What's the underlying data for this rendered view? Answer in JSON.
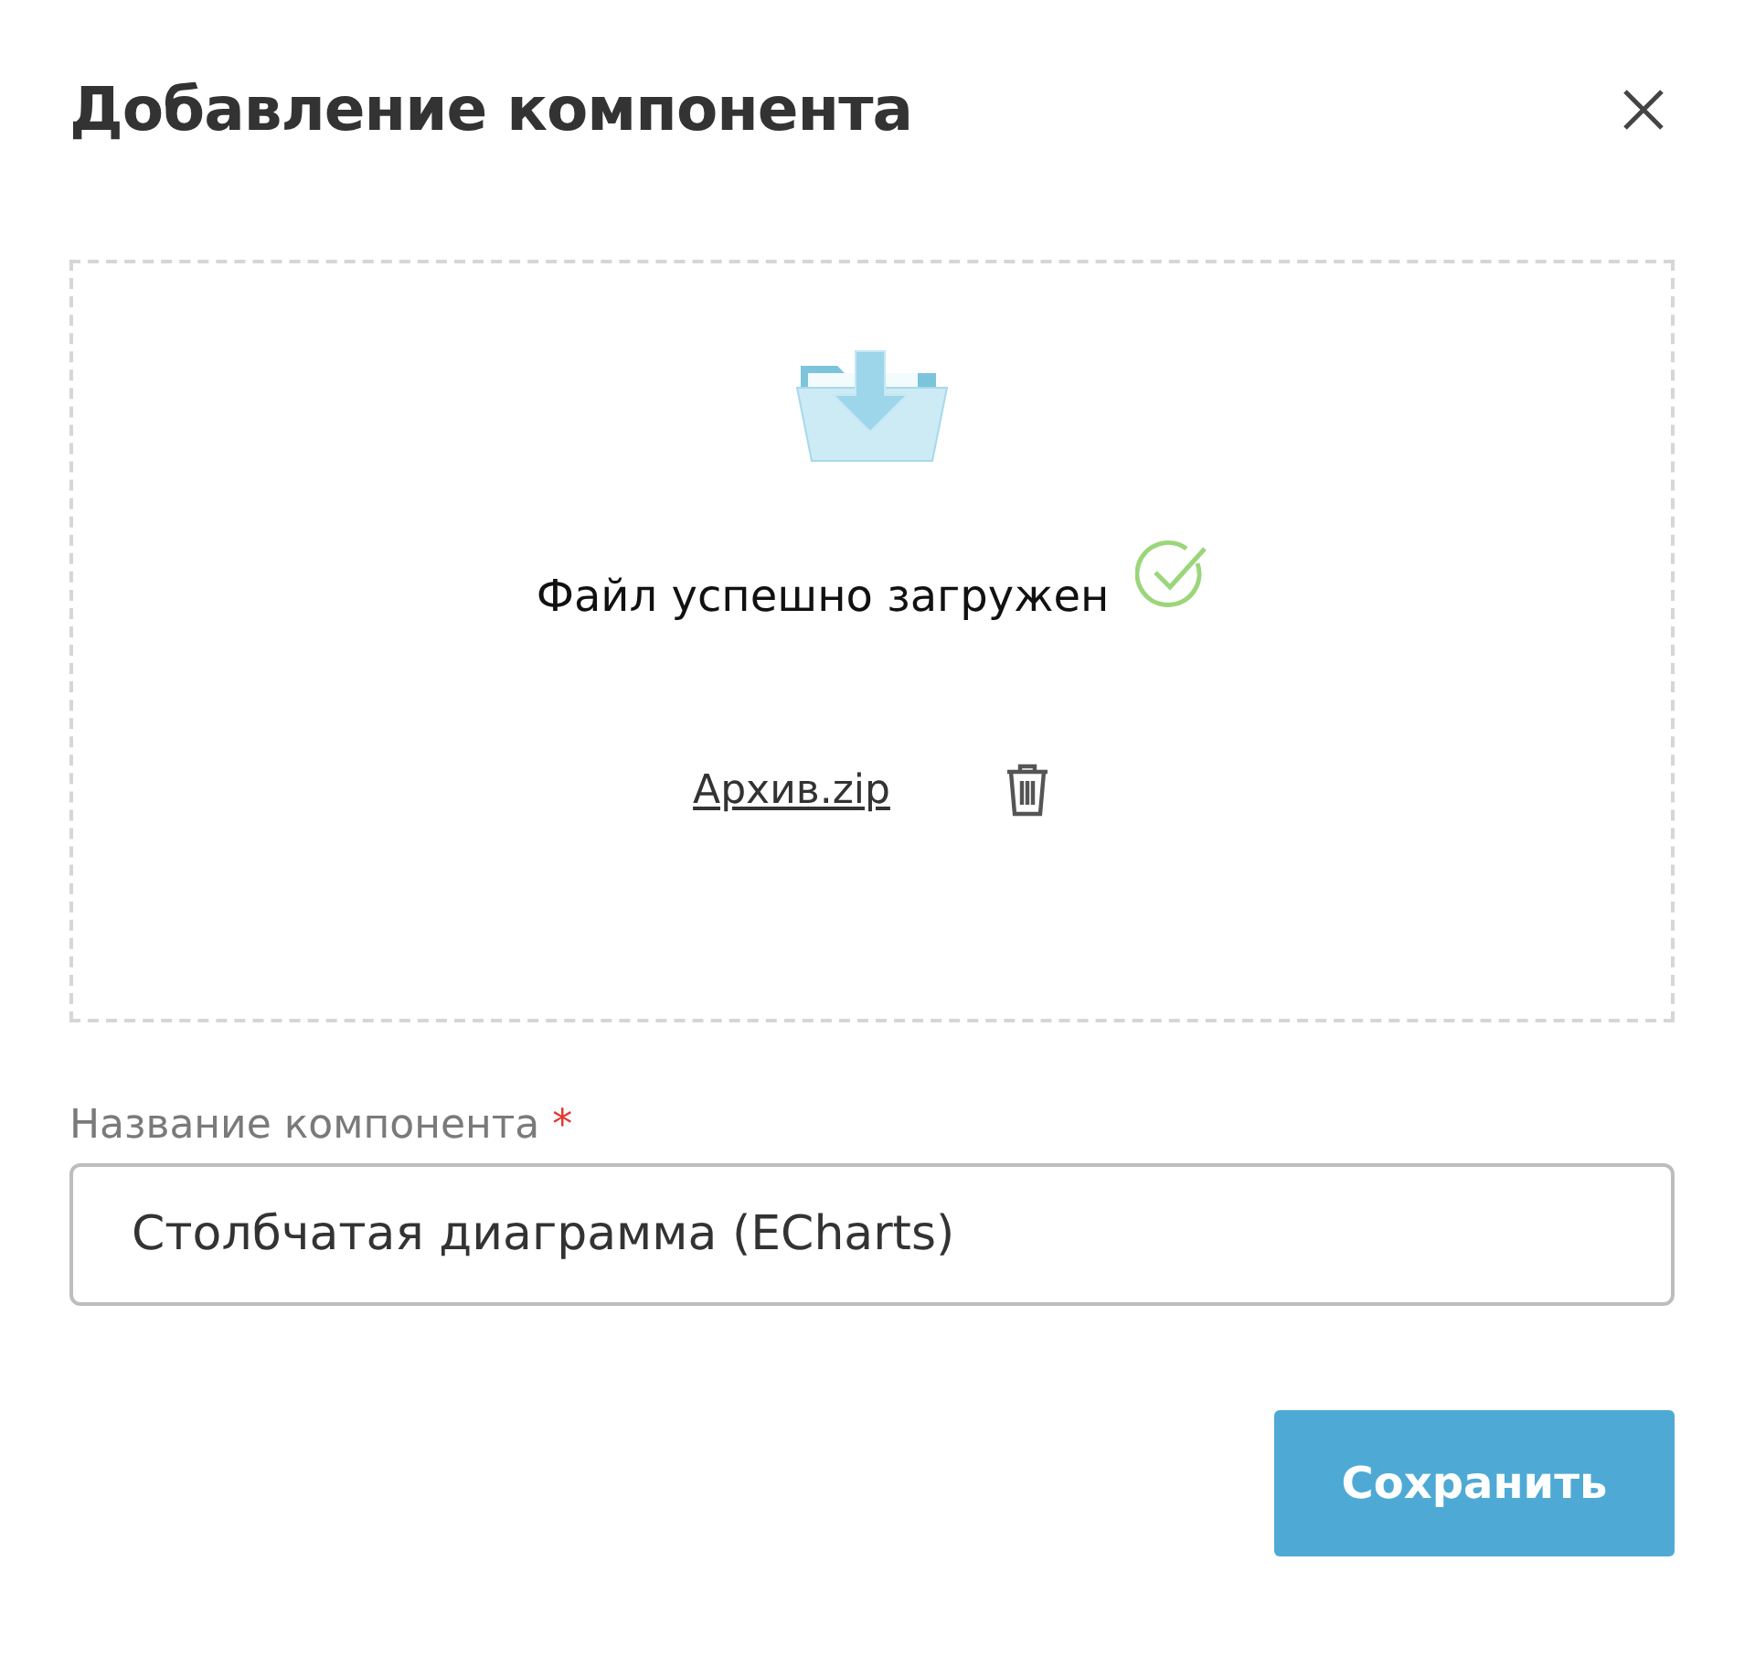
{
  "dialog": {
    "title": "Добавление компонента"
  },
  "upload": {
    "message": "Файл успешно загружен",
    "uploaded": true,
    "file_name": "Архив.zip"
  },
  "field": {
    "label": "Название компонента",
    "required_mark": "*",
    "value": "Столбчатая диаграмма (ECharts)"
  },
  "buttons": [
    {
      "label": "Сохранить",
      "kind": "primary"
    }
  ]
}
